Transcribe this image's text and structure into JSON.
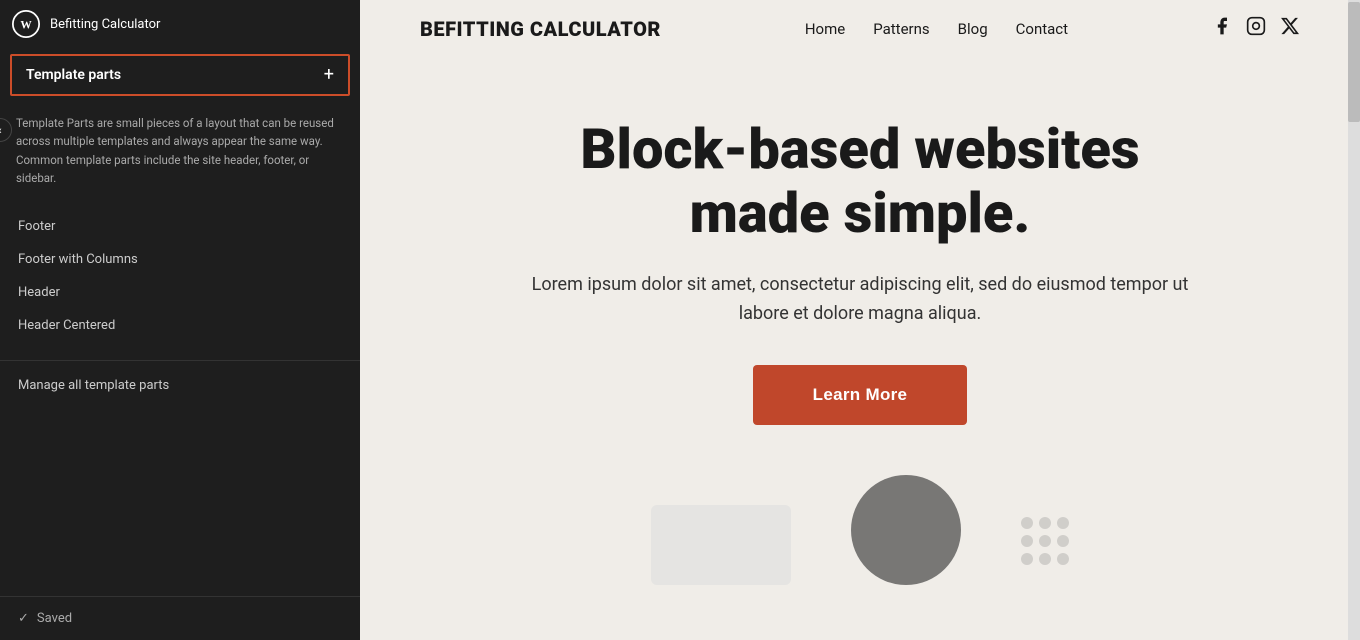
{
  "topbar": {
    "wp_logo_alt": "WordPress",
    "site_title": "Befitting Calculator"
  },
  "sidebar": {
    "back_arrow": "‹",
    "header": {
      "title": "Template parts",
      "add_label": "+"
    },
    "description": "Template Parts are small pieces of a layout that can be reused across multiple templates and always appear the same way. Common template parts include the site header, footer, or sidebar.",
    "items": [
      {
        "label": "Footer"
      },
      {
        "label": "Footer with Columns"
      },
      {
        "label": "Header"
      },
      {
        "label": "Header Centered"
      }
    ],
    "manage_link": "Manage all template parts",
    "saved_label": "Saved"
  },
  "preview": {
    "brand": "BEFITTING CALCULATOR",
    "nav": {
      "items": [
        "Home",
        "Patterns",
        "Blog",
        "Contact"
      ]
    },
    "social": {
      "facebook": "f",
      "instagram": "◎",
      "twitter": "𝕏"
    },
    "hero": {
      "title": "Block-based websites made simple.",
      "subtitle": "Lorem ipsum dolor sit amet, consectetur adipiscing elit, sed do eiusmod tempor ut labore et dolore magna aliqua.",
      "button_label": "Learn More"
    },
    "colors": {
      "hero_btn_bg": "#c0472b",
      "sidebar_border": "#cc4d29"
    }
  }
}
